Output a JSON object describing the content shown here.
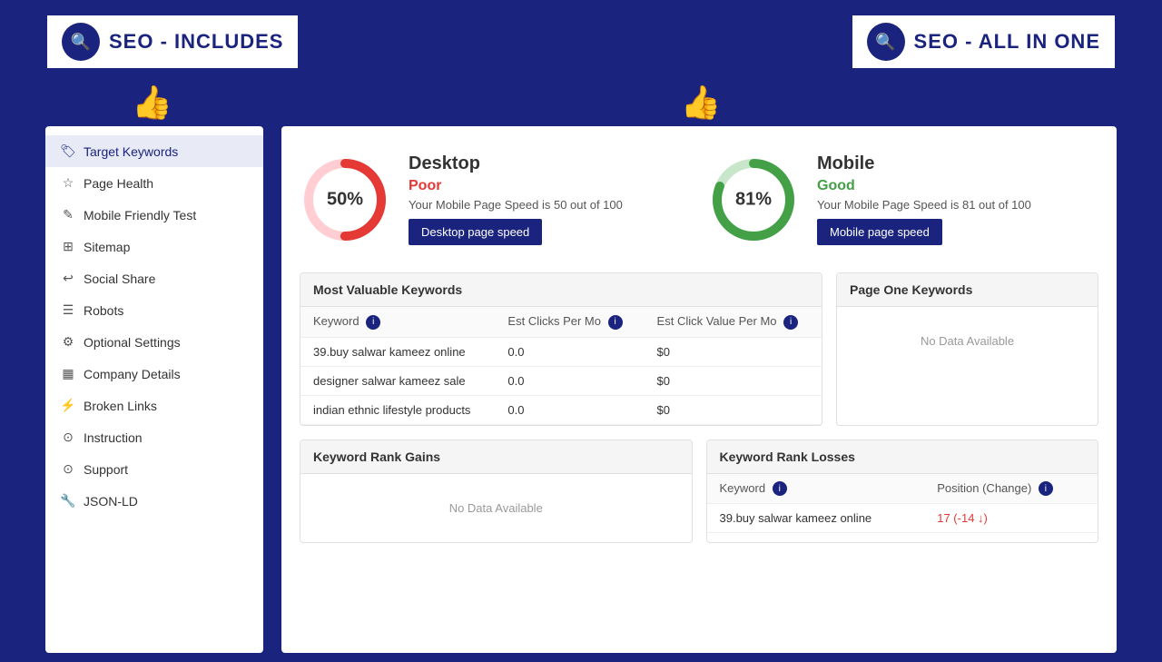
{
  "headers": {
    "left": {
      "title": "SEO - INCLUDES",
      "icon": "🔍"
    },
    "right": {
      "title": "SEO - ALL IN ONE",
      "icon": "🔍"
    }
  },
  "sidebar": {
    "items": [
      {
        "id": "target-keywords",
        "label": "Target Keywords",
        "icon": "🏷",
        "active": true
      },
      {
        "id": "page-health",
        "label": "Page Health",
        "icon": "☆"
      },
      {
        "id": "mobile-friendly",
        "label": "Mobile Friendly Test",
        "icon": "✎"
      },
      {
        "id": "sitemap",
        "label": "Sitemap",
        "icon": "⊞"
      },
      {
        "id": "social-share",
        "label": "Social Share",
        "icon": "↩"
      },
      {
        "id": "robots",
        "label": "Robots",
        "icon": "☰"
      },
      {
        "id": "optional-settings",
        "label": "Optional Settings",
        "icon": "⚙"
      },
      {
        "id": "company-details",
        "label": "Company Details",
        "icon": "▦"
      },
      {
        "id": "broken-links",
        "label": "Broken Links",
        "icon": "⚡"
      },
      {
        "id": "instruction",
        "label": "Instruction",
        "icon": "⊙"
      },
      {
        "id": "support",
        "label": "Support",
        "icon": "⊙"
      },
      {
        "id": "json-ld",
        "label": "JSON-LD",
        "icon": "🔧"
      }
    ]
  },
  "desktop": {
    "title": "Desktop",
    "score": 50,
    "percent": "50%",
    "status": "Poor",
    "description": "Your Mobile Page Speed is 50 out of 100",
    "button": "Desktop page speed",
    "color": "#e53935",
    "bg_color": "#ffcdd2"
  },
  "mobile": {
    "title": "Mobile",
    "score": 81,
    "percent": "81%",
    "status": "Good",
    "description": "Your Mobile Page Speed is 81 out of 100",
    "button": "Mobile page speed",
    "color": "#43a047",
    "bg_color": "#c8e6c9"
  },
  "most_valuable_keywords": {
    "title": "Most Valuable Keywords",
    "columns": [
      "Keyword",
      "Est Clicks Per Mo",
      "Est Click Value Per Mo"
    ],
    "rows": [
      {
        "keyword": "39.buy salwar kameez online",
        "clicks": "0.0",
        "value": "$0"
      },
      {
        "keyword": "designer salwar kameez sale",
        "clicks": "0.0",
        "value": "$0"
      },
      {
        "keyword": "indian ethnic lifestyle products",
        "clicks": "0.0",
        "value": "$0"
      }
    ]
  },
  "page_one_keywords": {
    "title": "Page One Keywords",
    "no_data": "No Data Available"
  },
  "keyword_rank_gains": {
    "title": "Keyword Rank Gains",
    "no_data": "No Data Available"
  },
  "keyword_rank_losses": {
    "title": "Keyword Rank Losses",
    "columns": [
      "Keyword",
      "Position (Change)"
    ],
    "rows": [
      {
        "keyword": "39.buy salwar kameez online",
        "position": "17 (-14 ↓)"
      }
    ]
  }
}
